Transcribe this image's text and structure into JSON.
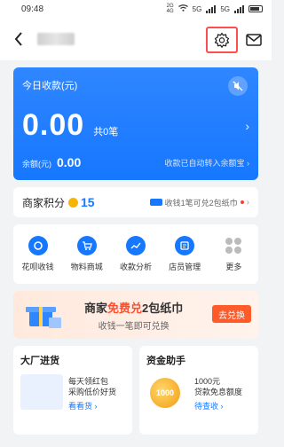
{
  "status": {
    "time": "09:48",
    "network": "2G\n4G",
    "signal_labels": [
      "5G",
      "5G"
    ]
  },
  "header": {
    "back_icon": "chevron-left-icon",
    "settings_icon": "gear-icon",
    "mail_icon": "mail-icon"
  },
  "blue_card": {
    "title": "今日收款(元)",
    "amount": "0.00",
    "count": "共0笔",
    "balance_label": "余额(元)",
    "balance_value": "0.00",
    "balance_note": "收款已自动转入余额宝"
  },
  "points": {
    "label": "商家积分",
    "value": "15",
    "tip": "收钱1笔可兑2包纸巾"
  },
  "grid_items": [
    {
      "label": "花呗收钱",
      "icon": "huabei-icon"
    },
    {
      "label": "物料商城",
      "icon": "cart-icon"
    },
    {
      "label": "收款分析",
      "icon": "chart-icon"
    },
    {
      "label": "店员管理",
      "icon": "clerk-icon"
    },
    {
      "label": "更多",
      "icon": "more-icon"
    }
  ],
  "promo": {
    "title_prefix": "商家",
    "title_highlight": "免费兑",
    "title_suffix": "2包纸巾",
    "subtitle": "收钱一笔即可兑换",
    "button": "去兑换"
  },
  "bottom_cards": [
    {
      "title": "大厂进货",
      "text1": "每天领红包",
      "text2": "采购低价好货",
      "link": "看看货"
    },
    {
      "title": "资金助手",
      "coin_label": "1000",
      "text1": "1000元",
      "text2": "贷款免息额度",
      "link": "待查收"
    }
  ],
  "colors": {
    "primary": "#1677ff",
    "orange": "#ff5a2a",
    "highlight": "#ff4d2d"
  }
}
